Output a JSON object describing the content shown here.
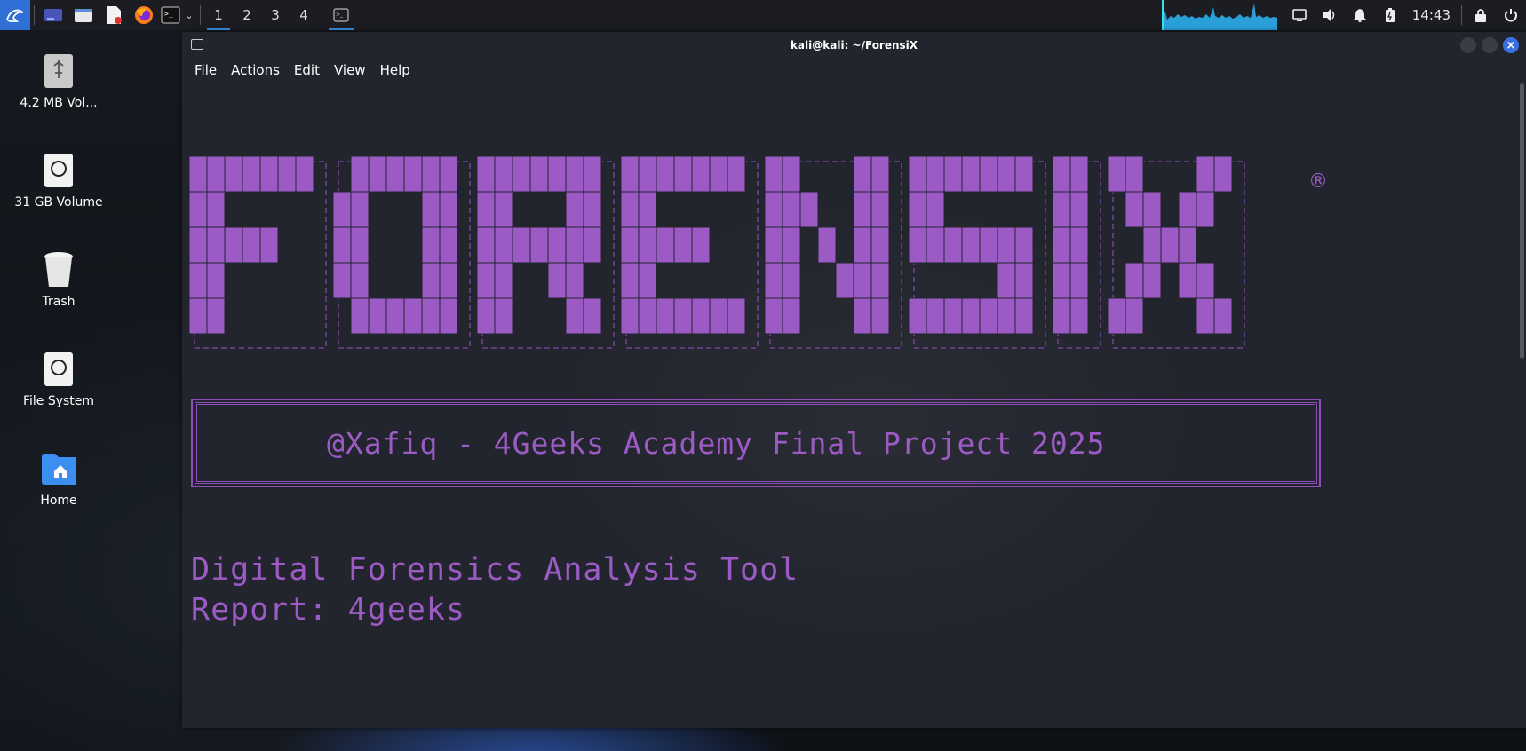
{
  "panel": {
    "workspaces": [
      "1",
      "2",
      "3",
      "4"
    ],
    "active_workspace": "1",
    "clock": "14:43",
    "icons": [
      "kali-menu-icon",
      "desktop-icon",
      "file-manager-icon",
      "text-editor-icon",
      "firefox-icon",
      "terminal-icon",
      "chevron-down-icon"
    ],
    "tray_icons": [
      "display-icon",
      "volume-icon",
      "notification-icon",
      "battery-icon",
      "lock-icon",
      "power-icon"
    ]
  },
  "desktop": {
    "icons": [
      {
        "label": "4.2 MB Vol...",
        "icon": "usb-drive-icon"
      },
      {
        "label": "31 GB Volume",
        "icon": "hard-disk-icon"
      },
      {
        "label": "Trash",
        "icon": "trash-icon"
      },
      {
        "label": "File System",
        "icon": "hard-disk-icon"
      },
      {
        "label": "Home",
        "icon": "home-folder-icon"
      }
    ]
  },
  "terminal": {
    "title": "kali@kali: ~/ForensiX",
    "menu": [
      "File",
      "Actions",
      "Edit",
      "View",
      "Help"
    ],
    "logo_text": "FORENSIX",
    "registered_mark": "®",
    "banner": "@Xafiq  - 4Geeks Academy Final Project 2025",
    "line1": "Digital Forensics Analysis Tool",
    "line2": "Report: 4geeks"
  },
  "colors": {
    "accent": "#9c5bc4",
    "terminal_bg": "#23252e",
    "panel_bg": "#1b1d22",
    "highlight": "#3a8ee6"
  }
}
